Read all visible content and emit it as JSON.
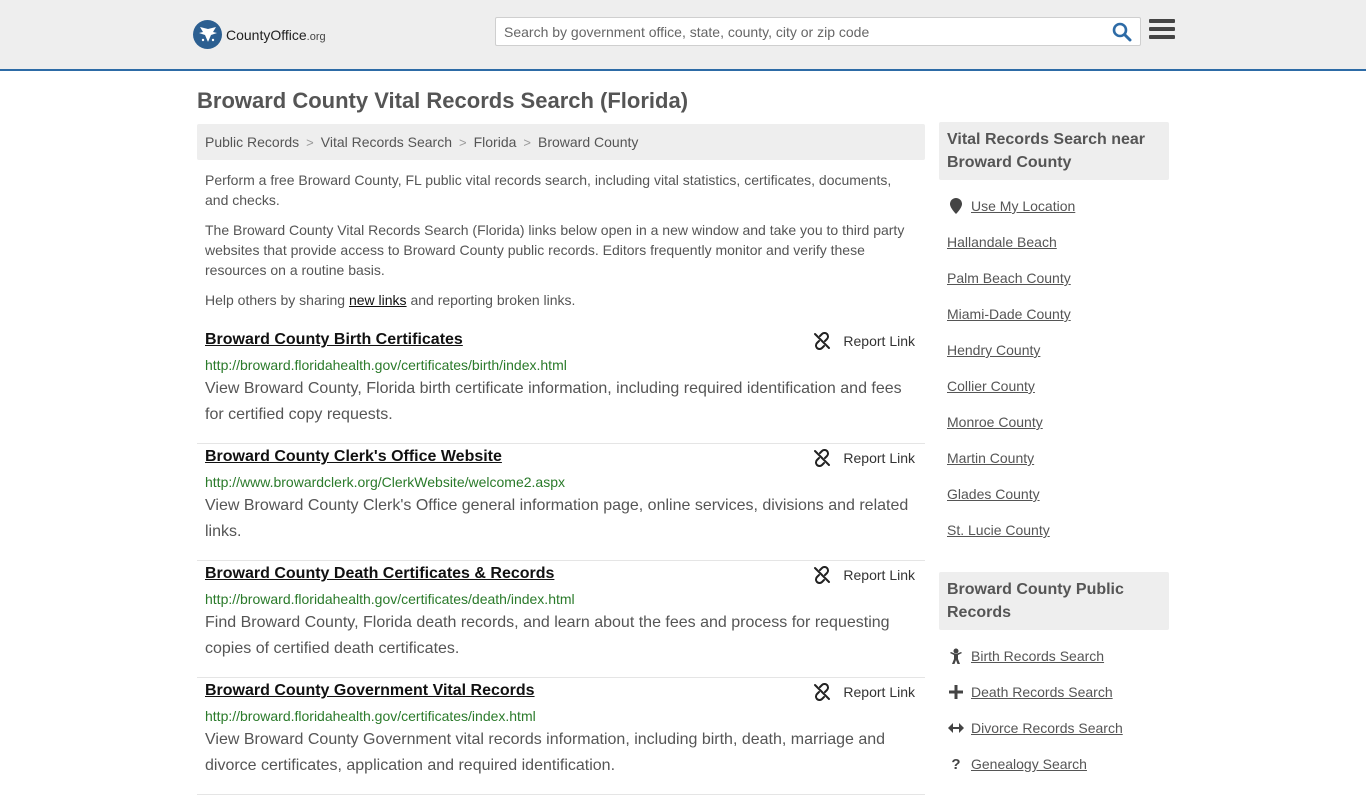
{
  "header": {
    "logo_text": "CountyOffice",
    "logo_suffix": ".org",
    "search_placeholder": "Search by government office, state, county, city or zip code"
  },
  "page_title": "Broward County Vital Records Search (Florida)",
  "breadcrumb": [
    "Public Records",
    "Vital Records Search",
    "Florida",
    "Broward County"
  ],
  "intro": {
    "p1": "Perform a free Broward County, FL public vital records search, including vital statistics, certificates, documents, and checks.",
    "p2": "The Broward County Vital Records Search (Florida) links below open in a new window and take you to third party websites that provide access to Broward County public records. Editors frequently monitor and verify these resources on a routine basis.",
    "p3_before": "Help others by sharing ",
    "p3_link": "new links",
    "p3_after": " and reporting broken links."
  },
  "report_label": "Report Link",
  "results": [
    {
      "title": "Broward County Birth Certificates",
      "url": "http://broward.floridahealth.gov/certificates/birth/index.html",
      "desc": "View Broward County, Florida birth certificate information, including required identification and fees for certified copy requests."
    },
    {
      "title": "Broward County Clerk's Office Website",
      "url": "http://www.browardclerk.org/ClerkWebsite/welcome2.aspx",
      "desc": "View Broward County Clerk's Office general information page, online services, divisions and related links."
    },
    {
      "title": "Broward County Death Certificates & Records",
      "url": "http://broward.floridahealth.gov/certificates/death/index.html",
      "desc": "Find Broward County, Florida death records, and learn about the fees and process for requesting copies of certified death certificates."
    },
    {
      "title": "Broward County Government Vital Records",
      "url": "http://broward.floridahealth.gov/certificates/index.html",
      "desc": "View Broward County Government vital records information, including birth, death, marriage and divorce certificates, application and required identification."
    }
  ],
  "sidebar": {
    "near_title": "Vital Records Search near Broward County",
    "use_location": "Use My Location",
    "near_items": [
      "Hallandale Beach",
      "Palm Beach County",
      "Miami-Dade County",
      "Hendry County",
      "Collier County",
      "Monroe County",
      "Martin County",
      "Glades County",
      "St. Lucie County"
    ],
    "public_title": "Broward County Public Records",
    "public_items": [
      {
        "label": "Birth Records Search",
        "icon": "baby-icon"
      },
      {
        "label": "Death Records Search",
        "icon": "cross-icon"
      },
      {
        "label": "Divorce Records Search",
        "icon": "arrows-horizontal-icon"
      },
      {
        "label": "Genealogy Search",
        "icon": "question-icon"
      }
    ]
  }
}
